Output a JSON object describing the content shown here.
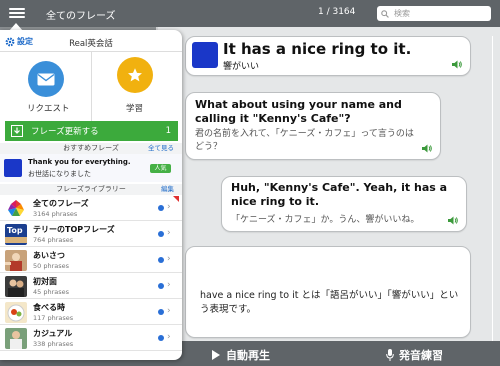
{
  "topbar": {
    "list_title": "全てのフレーズ",
    "counter": "1 / 3164",
    "search_placeholder": "検索"
  },
  "conversation": [
    {
      "speaker": "A",
      "en": "It has a nice ring to it.",
      "jp": "響がいい"
    },
    {
      "speaker": "B",
      "en": "What about using your name and calling it \"Kenny's Cafe\"?",
      "jp": "君の名前を入れて、「ケニーズ・カフェ」って言うのはどう？"
    },
    {
      "speaker": "A",
      "en": "Huh, \"Kenny's Cafe\". Yeah, it has a nice ring to it.",
      "jp": "「ケニーズ・カフェ」か。うん、響がいいね。"
    }
  ],
  "note": "have a nice ring to it とは「語呂がいい」「響がいい」という表現です。",
  "bottombar": {
    "autoplay_label": "自動再生",
    "voice_label": "発音練習"
  },
  "sidebar": {
    "settings_label": "設定",
    "title": "Real英会話",
    "request_label": "リクエスト",
    "study_label": "学習",
    "update_label": "フレーズ更新する",
    "update_count": "1",
    "recommended_header": "おすすめフレーズ",
    "see_all": "全て見る",
    "recommended": {
      "en": "Thank you for everything.",
      "jp": "お世話になりました",
      "badge": "人気"
    },
    "library_header": "フレーズライブラリー",
    "edit_label": "編集",
    "library": [
      {
        "name": "全てのフレーズ",
        "count": "3164 phrases"
      },
      {
        "name": "テリーのTOPフレーズ",
        "count": "764 phrases"
      },
      {
        "name": "あいさつ",
        "count": "50 phrases"
      },
      {
        "name": "初対面",
        "count": "45 phrases"
      },
      {
        "name": "食べる時",
        "count": "117 phrases"
      },
      {
        "name": "カジュアル",
        "count": "338 phrases"
      }
    ]
  },
  "colors": {
    "accent_blue": "#1a68c8",
    "flag_blue": "#1a37c8",
    "update_green": "#3caa3c",
    "speaker_green": "#3c9a3c",
    "study_yellow": "#f1b10f",
    "request_blue": "#3a8fd9",
    "bar_gray": "#5f6468"
  },
  "icons": [
    "menu-icon",
    "search-icon",
    "gear-icon",
    "mail-icon",
    "star-icon",
    "download-icon",
    "speaker-icon",
    "play-icon",
    "microphone-icon",
    "chevron-right-icon"
  ]
}
